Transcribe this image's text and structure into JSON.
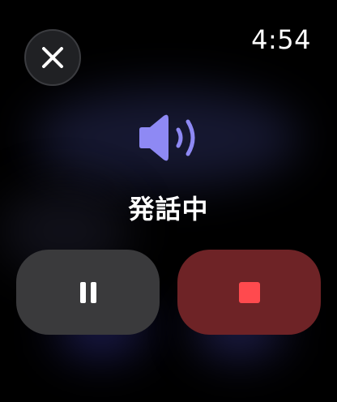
{
  "status_bar": {
    "time": "4:54"
  },
  "close_button": {
    "icon": "close-icon"
  },
  "speaker": {
    "icon": "speaker-wave-icon",
    "color": "#8E89F4"
  },
  "status": {
    "text": "発話中"
  },
  "controls": {
    "pause": {
      "icon": "pause-icon",
      "background": "#3A3A3C"
    },
    "stop": {
      "icon": "stop-icon",
      "background": "#6E2326",
      "accent": "#FF4A4E"
    }
  }
}
